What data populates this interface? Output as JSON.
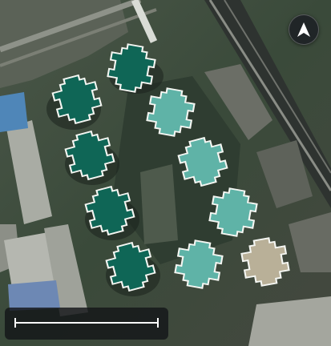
{
  "map": {
    "imagery": "satellite",
    "orientation": "north-up",
    "buildings": [
      {
        "id": "b1",
        "shade": "dark"
      },
      {
        "id": "b2",
        "shade": "dark"
      },
      {
        "id": "b3",
        "shade": "dark"
      },
      {
        "id": "b4",
        "shade": "dark"
      },
      {
        "id": "b5",
        "shade": "dark"
      },
      {
        "id": "b6",
        "shade": "medium"
      },
      {
        "id": "b7",
        "shade": "medium"
      },
      {
        "id": "b8",
        "shade": "medium"
      },
      {
        "id": "b9",
        "shade": "medium"
      },
      {
        "id": "b10",
        "shade": "tan"
      }
    ]
  },
  "compass": {
    "icon": "north-arrow-icon"
  },
  "scale": {
    "label": ""
  },
  "colors": {
    "dark": "#0f6656",
    "medium": "#5fb3a7",
    "tan": "#b9b098",
    "outline": "#f4f6f2",
    "compass_bg": "#1e2226",
    "scale_panel": "#141618"
  }
}
